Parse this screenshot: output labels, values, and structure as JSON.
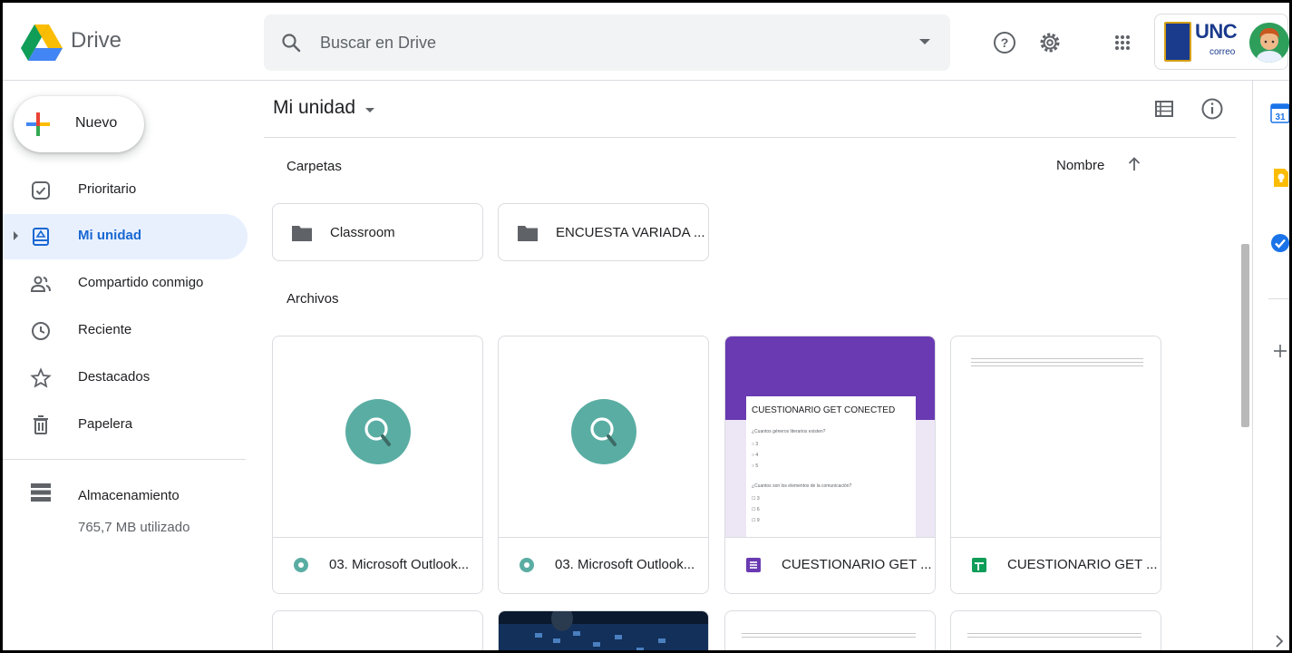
{
  "header": {
    "brand": "Drive",
    "search_placeholder": "Buscar en Drive",
    "icons": [
      "help-icon",
      "settings-icon",
      "apps-grid-icon"
    ],
    "account": {
      "org": "UNC",
      "sub": "correo"
    }
  },
  "sidebar": {
    "new_button": "Nuevo",
    "items": [
      {
        "label": "Prioritario",
        "icon": "priority-icon",
        "active": false
      },
      {
        "label": "Mi unidad",
        "icon": "my-drive-icon",
        "active": true
      },
      {
        "label": "Compartido conmigo",
        "icon": "shared-icon",
        "active": false
      },
      {
        "label": "Reciente",
        "icon": "clock-icon",
        "active": false
      },
      {
        "label": "Destacados",
        "icon": "star-icon",
        "active": false
      },
      {
        "label": "Papelera",
        "icon": "trash-icon",
        "active": false
      }
    ],
    "storage": {
      "label": "Almacenamiento",
      "used": "765,7 MB utilizado"
    }
  },
  "main": {
    "title": "Mi unidad",
    "folders_label": "Carpetas",
    "sort_label": "Nombre",
    "files_label": "Archivos",
    "folders": [
      {
        "name": "Classroom"
      },
      {
        "name": "ENCUESTA VARIADA ..."
      }
    ],
    "files": [
      {
        "name": "03. Microsoft Outlook...",
        "type": "video",
        "color": "#5aada3"
      },
      {
        "name": "03. Microsoft Outlook...",
        "type": "video",
        "color": "#5aada3"
      },
      {
        "name": "CUESTIONARIO GET ...",
        "type": "form",
        "color": "#6a3ab2"
      },
      {
        "name": "CUESTIONARIO GET ...",
        "type": "sheet",
        "color": "#0f9d58"
      }
    ],
    "form_preview": {
      "title": "CUESTIONARIO GET CONECTED",
      "q1": "¿Cuantos géneros literarios existen?",
      "q1_opts": [
        "○ 3",
        "○ 4",
        "○ 5"
      ],
      "q2": "¿Cuantos son los elementos de la comunicación?",
      "q2_opts": [
        "☐ 3",
        "☐ 6",
        "☐ 9"
      ]
    }
  },
  "right_panel": {
    "calendar_day": "31",
    "colors": {
      "calendar": "#1a73e8",
      "keep": "#fbbc04",
      "tasks": "#1a73e8"
    }
  },
  "colors": {
    "accent": "#1967d2",
    "active_bg": "#e8f0fe",
    "video_thumb": "#5aada3",
    "form": "#6a3ab2",
    "sheet": "#0f9d58"
  }
}
